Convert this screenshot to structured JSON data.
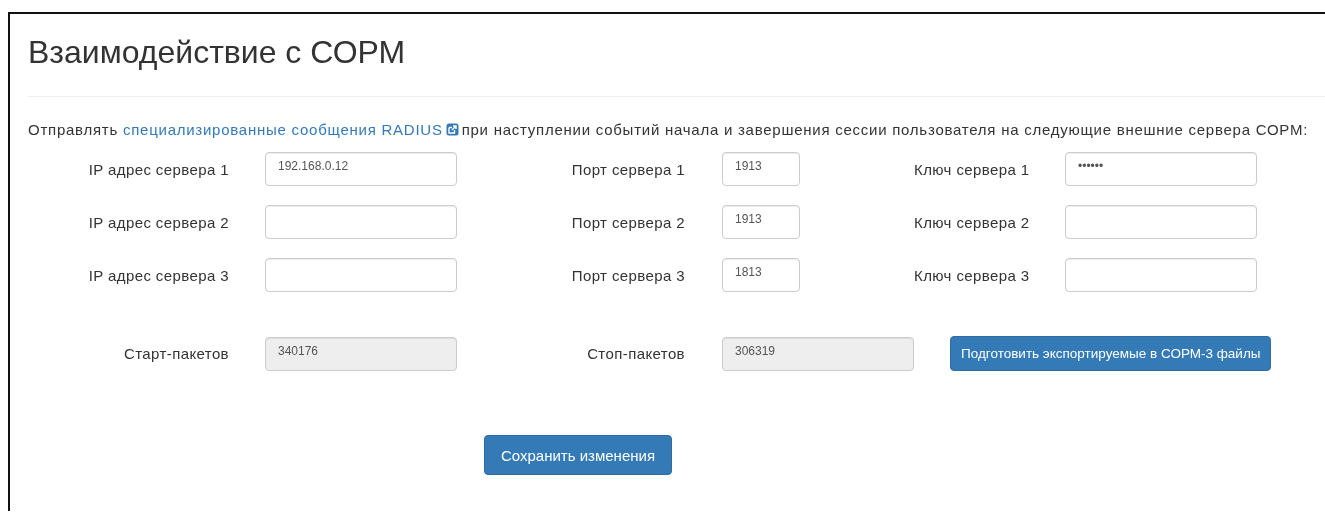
{
  "title": "Взаимодействие с СОРМ",
  "intro": {
    "before": "Отправлять",
    "link": "специализированные сообщения RADIUS",
    "after": "при наступлении событий начала и завершения сессии пользователя на следующие внешние сервера СОРМ:"
  },
  "servers": [
    {
      "ip_label": "IP адрес сервера 1",
      "ip_value": "192.168.0.12",
      "port_label": "Порт сервера 1",
      "port_value": "1913",
      "key_label": "Ключ сервера 1",
      "key_value": "••••••"
    },
    {
      "ip_label": "IP адрес сервера 2",
      "port_label": "Порт сервера 2",
      "port_value": "1913",
      "key_label": "Ключ сервера 2"
    },
    {
      "ip_label": "IP адрес сервера 3",
      "port_label": "Порт сервера 3",
      "port_value": "1813",
      "key_label": "Ключ сервера 3"
    }
  ],
  "counters": [
    {
      "label": "Старт-пакетов",
      "value": "340176",
      "disabled": true
    },
    {
      "label": "Стоп-пакетов",
      "value": "306319",
      "disabled": true
    }
  ],
  "export_button": "Подготовить экспортируемые в СОРМ-3 файлы",
  "save_button": "Сохранить изменения"
}
